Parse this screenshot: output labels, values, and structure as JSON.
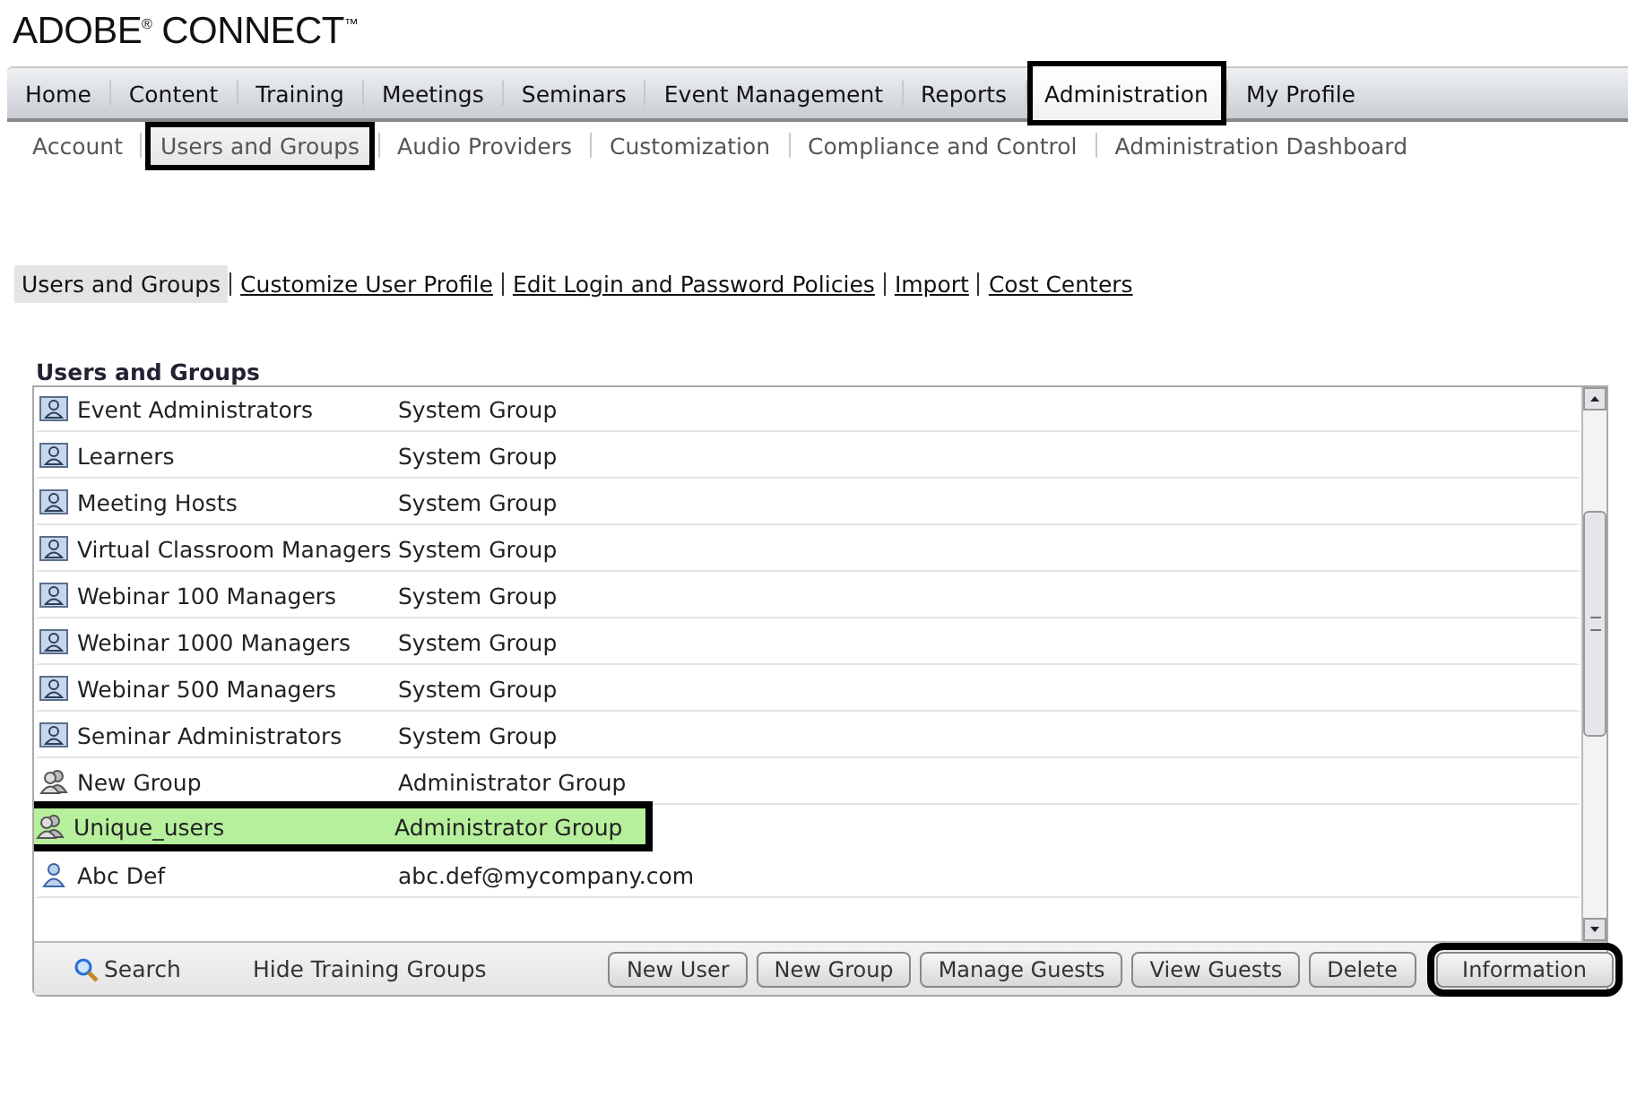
{
  "logo": "ADOBE$^{®}$ CONNECT$^{™}$",
  "main_nav": [
    {
      "label": "Home",
      "selected": false,
      "outlined": false
    },
    {
      "label": "Content",
      "selected": false,
      "outlined": false
    },
    {
      "label": "Training",
      "selected": false,
      "outlined": false
    },
    {
      "label": "Meetings",
      "selected": false,
      "outlined": false
    },
    {
      "label": "Seminars",
      "selected": false,
      "outlined": false
    },
    {
      "label": "Event Management",
      "selected": false,
      "outlined": false
    },
    {
      "label": "Reports",
      "selected": false,
      "outlined": false
    },
    {
      "label": "Administration",
      "selected": true,
      "outlined": true
    },
    {
      "label": "My Profile",
      "selected": false,
      "outlined": false
    }
  ],
  "sub_nav": [
    {
      "label": "Account",
      "selected": false,
      "outlined": false
    },
    {
      "label": "Users and Groups",
      "selected": true,
      "outlined": true
    },
    {
      "label": "Audio Providers",
      "selected": false,
      "outlined": false
    },
    {
      "label": "Customization",
      "selected": false,
      "outlined": false
    },
    {
      "label": "Compliance and Control",
      "selected": false,
      "outlined": false
    },
    {
      "label": "Administration Dashboard",
      "selected": false,
      "outlined": false
    }
  ],
  "section_tabs": [
    {
      "label": "Users and Groups",
      "selected": true
    },
    {
      "label": "Customize User Profile",
      "selected": false
    },
    {
      "label": "Edit Login and Password Policies",
      "selected": false
    },
    {
      "label": "Import",
      "selected": false
    },
    {
      "label": "Cost Centers",
      "selected": false
    }
  ],
  "list": {
    "title": "Users and Groups",
    "rows": [
      {
        "kind": "system",
        "name": "Event Administrators",
        "type": "System Group",
        "selected": false,
        "outlined": false
      },
      {
        "kind": "system",
        "name": "Learners",
        "type": "System Group",
        "selected": false,
        "outlined": false
      },
      {
        "kind": "system",
        "name": "Meeting Hosts",
        "type": "System Group",
        "selected": false,
        "outlined": false
      },
      {
        "kind": "system",
        "name": "Virtual Classroom Managers",
        "type": "System Group",
        "selected": false,
        "outlined": false
      },
      {
        "kind": "system",
        "name": "Webinar 100 Managers",
        "type": "System Group",
        "selected": false,
        "outlined": false
      },
      {
        "kind": "system",
        "name": "Webinar 1000 Managers",
        "type": "System Group",
        "selected": false,
        "outlined": false
      },
      {
        "kind": "system",
        "name": "Webinar 500 Managers",
        "type": "System Group",
        "selected": false,
        "outlined": false
      },
      {
        "kind": "system",
        "name": "Seminar Administrators",
        "type": "System Group",
        "selected": false,
        "outlined": false
      },
      {
        "kind": "group",
        "name": "New Group",
        "type": "Administrator Group",
        "selected": false,
        "outlined": false
      },
      {
        "kind": "group",
        "name": "Unique_users",
        "type": "Administrator Group",
        "selected": true,
        "outlined": true
      },
      {
        "kind": "user",
        "name": "Abc Def",
        "type": "abc.def@mycompany.com",
        "selected": false,
        "outlined": false
      }
    ],
    "search": "Search",
    "hide_link": "Hide Training Groups",
    "buttons": [
      {
        "label": "New User",
        "outlined": false
      },
      {
        "label": "New Group",
        "outlined": false
      },
      {
        "label": "Manage Guests",
        "outlined": false
      },
      {
        "label": "View Guests",
        "outlined": false
      },
      {
        "label": "Delete",
        "outlined": false
      },
      {
        "label": "Information",
        "outlined": true
      }
    ]
  }
}
